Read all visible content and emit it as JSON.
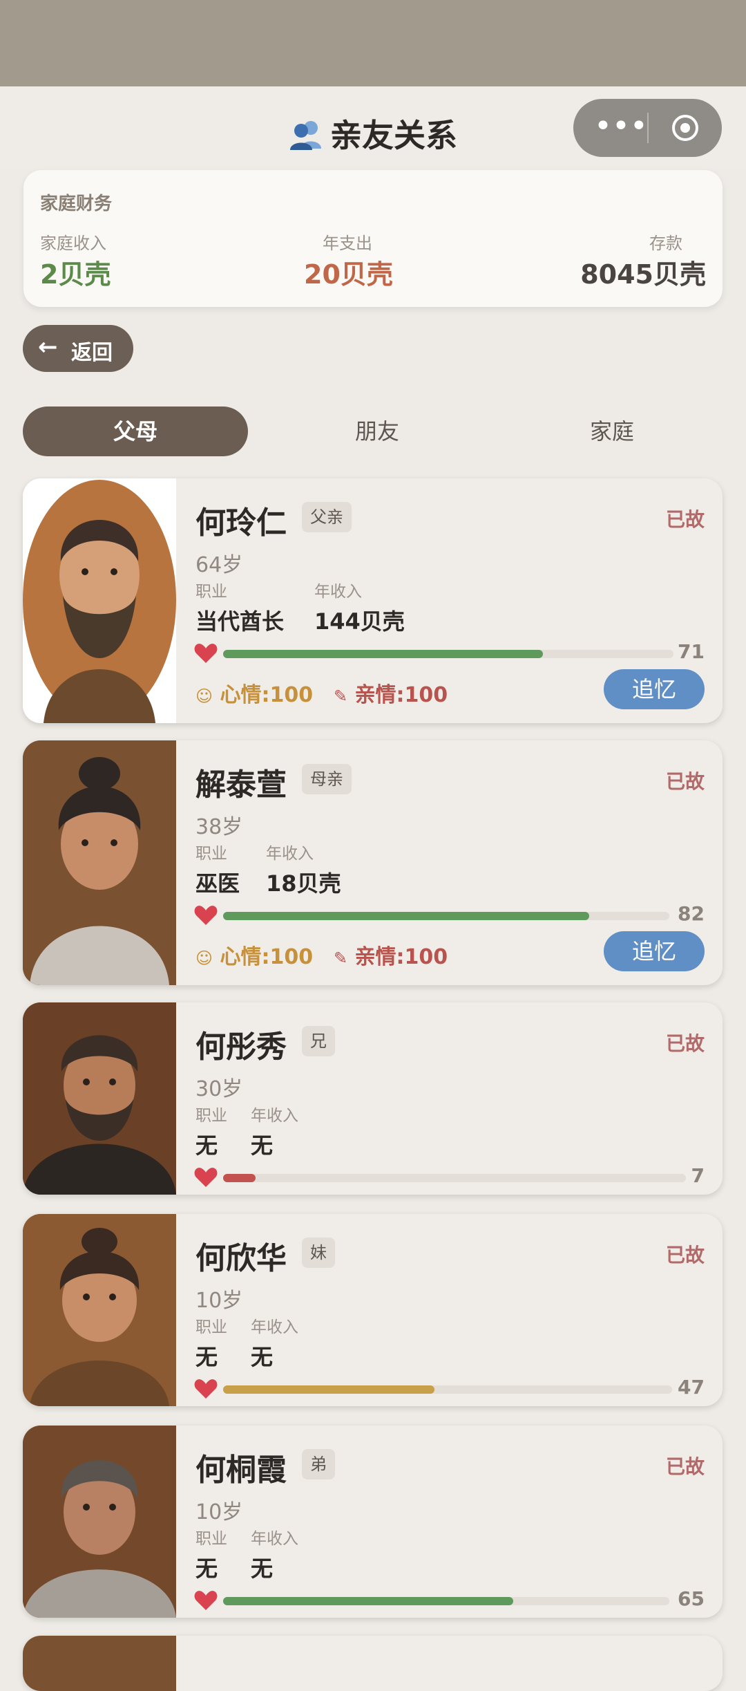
{
  "header": {
    "title": "亲友关系"
  },
  "finance": {
    "title": "家庭财务",
    "income_label": "家庭收入",
    "income_value": "2贝壳",
    "expense_label": "年支出",
    "expense_value": "20贝壳",
    "savings_label": "存款",
    "savings_value": "8045贝壳"
  },
  "back_button": "返回",
  "tabs": [
    "父母",
    "朋友",
    "家庭"
  ],
  "relatives": [
    {
      "name": "何玲仁",
      "relation": "父亲",
      "status": "已故",
      "age": "64岁",
      "job_label": "职业",
      "income_label": "年收入",
      "job": "当代酋长",
      "income": "144贝壳",
      "health": 71,
      "health_text": "71",
      "health_color": "#5e9a5c",
      "mood": "心情:100",
      "kinship": "亲情:100",
      "action": "追忆"
    },
    {
      "name": "解泰萱",
      "relation": "母亲",
      "status": "已故",
      "age": "38岁",
      "job_label": "职业",
      "income_label": "年收入",
      "job": "巫医",
      "income": "18贝壳",
      "health": 82,
      "health_text": "82",
      "health_color": "#5e9a5c",
      "mood": "心情:100",
      "kinship": "亲情:100",
      "action": "追忆"
    },
    {
      "name": "何彤秀",
      "relation": "兄",
      "status": "已故",
      "age": "30岁",
      "job_label": "职业",
      "income_label": "年收入",
      "job": "无",
      "income": "无",
      "health": 7,
      "health_text": "7",
      "health_color": "#c3514d"
    },
    {
      "name": "何欣华",
      "relation": "妹",
      "status": "已故",
      "age": "10岁",
      "job_label": "职业",
      "income_label": "年收入",
      "job": "无",
      "income": "无",
      "health": 47,
      "health_text": "47",
      "health_color": "#c9a04a"
    },
    {
      "name": "何桐霞",
      "relation": "弟",
      "status": "已故",
      "age": "10岁",
      "job_label": "职业",
      "income_label": "年收入",
      "job": "无",
      "income": "无",
      "health": 65,
      "health_text": "65",
      "health_color": "#5e9a5c"
    }
  ]
}
